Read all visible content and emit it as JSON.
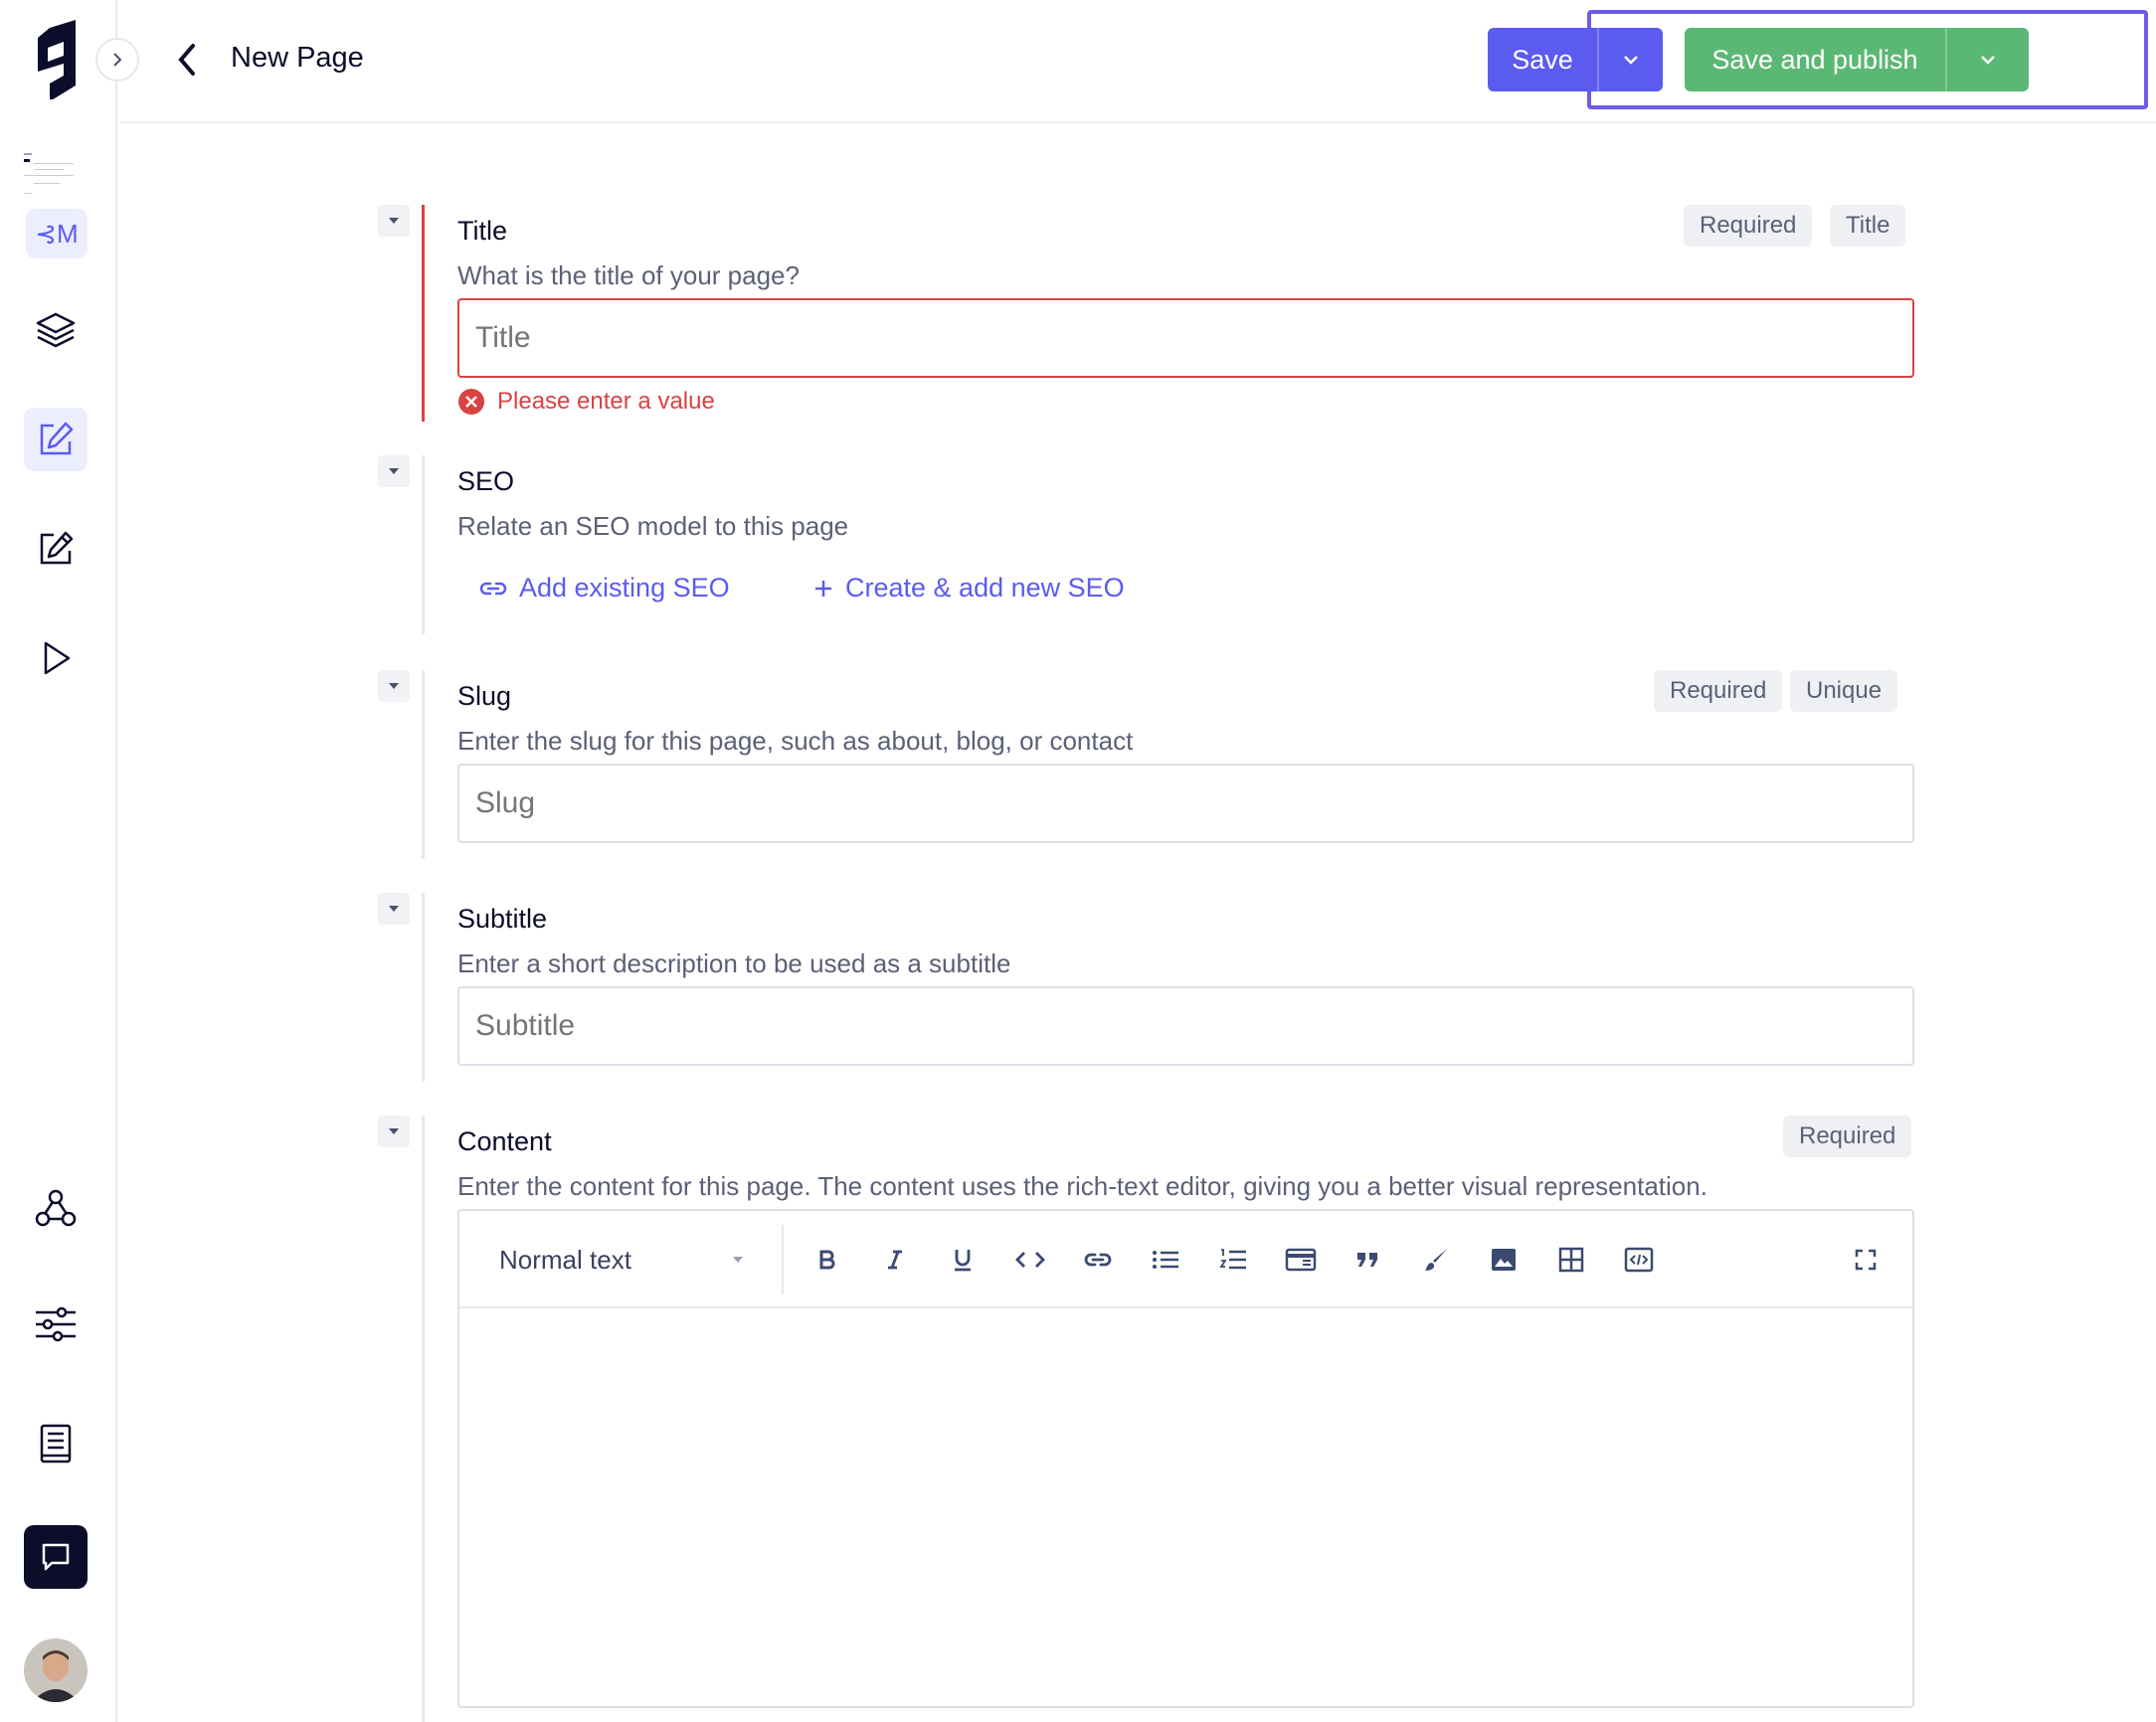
{
  "header": {
    "page_title": "New Page",
    "save_label": "Save",
    "publish_label": "Save and publish"
  },
  "rail": {
    "cm_badge": "⊰M"
  },
  "colors": {
    "primary": "#5b5bf0",
    "publish": "#5bb874",
    "error": "#d94243",
    "highlight": "#6d5ce7"
  },
  "fields": {
    "title": {
      "label": "Title",
      "description": "What is the title of your page?",
      "placeholder": "Title",
      "tags": [
        "Required",
        "Title"
      ],
      "error": "Please enter a value"
    },
    "seo": {
      "label": "SEO",
      "description": "Relate an SEO model to this page",
      "add_existing": "Add existing SEO",
      "create_new": "Create & add new SEO"
    },
    "slug": {
      "label": "Slug",
      "description": "Enter the slug for this page, such as about, blog, or contact",
      "placeholder": "Slug",
      "tags": [
        "Required",
        "Unique"
      ]
    },
    "subtitle": {
      "label": "Subtitle",
      "description": "Enter a short description to be used as a subtitle",
      "placeholder": "Subtitle"
    },
    "content": {
      "label": "Content",
      "description": "Enter the content for this page. The content uses the rich-text editor, giving you a better visual representation.",
      "tags": [
        "Required"
      ],
      "format_select": "Normal text"
    }
  }
}
